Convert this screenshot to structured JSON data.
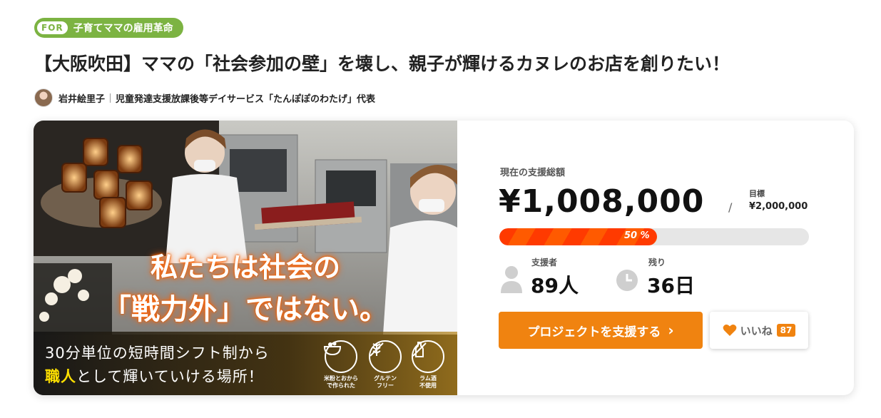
{
  "tag": {
    "prefix": "FOR",
    "label": "子育てママの雇用革命"
  },
  "title": "【大阪吹田】ママの「社会参加の壁」を壊し、親子が輝けるカヌレのお店を創りたい！",
  "owner": {
    "name": "岩井絵里子",
    "role": "児童発達支援放課後等デイサービス「たんぽぽのわたげ」代表"
  },
  "hero": {
    "headline_line1": "私たちは社会の",
    "headline_line2": "「戦力外」ではない。",
    "band_line1": "30分単位の短時間シフト制から",
    "band_line2_highlight": "職人",
    "band_line2_rest": "として輝いていける場所！",
    "badges": [
      {
        "icon": "rice-flour-icon",
        "label": "米粉とおから\nで作られた"
      },
      {
        "icon": "gluten-free-icon",
        "label": "グルテン\nフリー"
      },
      {
        "icon": "no-rum-icon",
        "label": "ラム酒\n不使用"
      }
    ]
  },
  "stats": {
    "total_label": "現在の支援総額",
    "total_amount": "¥1,008,000",
    "goal_separator": "/",
    "goal_label": "目標",
    "goal_amount": "¥2,000,000",
    "progress_percent": 50,
    "progress_text": "50 %",
    "supporters_label": "支援者",
    "supporters_value": "89人",
    "remaining_label": "残り",
    "remaining_value": "36日"
  },
  "actions": {
    "support_label": "プロジェクトを支援する",
    "support_chevron": "›",
    "like_label": "いいね",
    "like_count": "87"
  },
  "colors": {
    "accent": "#f08310",
    "tag_green": "#7cb342",
    "progress": "#ff4a00"
  }
}
